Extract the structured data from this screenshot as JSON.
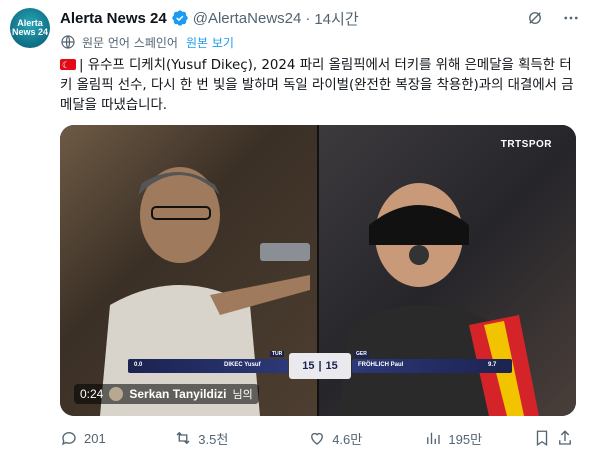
{
  "author": {
    "avatar_text": "Alerta\nNews 24",
    "name": "Alerta News 24",
    "handle": "@AlertaNews24",
    "separator": "·",
    "time": "14시간"
  },
  "translation": {
    "label": "원문 언어 스페인어",
    "show_original": "원본 보기"
  },
  "post": {
    "text": "| 유수프 디케치(Yusuf Dikeç), 2024 파리 올림픽에서 터키를 위해 은메달을 획득한 터키 올림픽 선수, 다시 한 번 빛을 발하며 독일 라이벌(완전한 복장을 착용한)과의 대결에서 금메달을 따냈습니다."
  },
  "media": {
    "broadcaster": "TRTSPOR",
    "score": {
      "left_team": "TUR",
      "right_team": "GER",
      "left_player": "DIKEC Yusuf",
      "right_player": "FRÖHLICH Paul",
      "left_score": "15",
      "right_score": "15",
      "left_shot": "0.0",
      "right_shot": "9.7"
    },
    "duration": "0:24",
    "uploader": "Serkan Tanyildizi",
    "uploader_suffix": "님의"
  },
  "actions": {
    "replies": "201",
    "reposts": "3.5천",
    "likes": "4.6만",
    "views": "195만"
  },
  "colors": {
    "text_primary": "#0f1419",
    "text_secondary": "#536471",
    "accent": "#1d9bf0"
  }
}
